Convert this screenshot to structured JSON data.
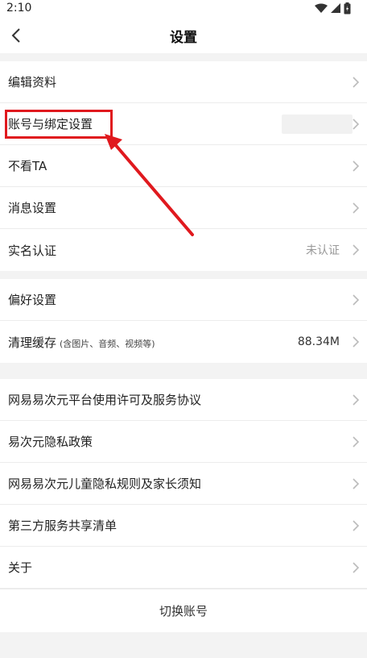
{
  "status": {
    "time": "2:10"
  },
  "header": {
    "title": "设置"
  },
  "groups": [
    {
      "items": [
        {
          "label": "编辑资料"
        },
        {
          "label": "账号与绑定设置"
        },
        {
          "label": "不看TA"
        },
        {
          "label": "消息设置"
        },
        {
          "label": "实名认证",
          "value": "未认证"
        }
      ]
    },
    {
      "items": [
        {
          "label": "偏好设置"
        },
        {
          "label": "清理缓存",
          "sub": "(含图片、音频、视频等)",
          "value": "88.34M"
        }
      ]
    },
    {
      "items": [
        {
          "label": "网易易次元平台使用许可及服务协议"
        },
        {
          "label": "易次元隐私政策"
        },
        {
          "label": "网易易次元儿童隐私规则及家长须知"
        },
        {
          "label": "第三方服务共享清单"
        },
        {
          "label": "关于"
        }
      ]
    }
  ],
  "footer": {
    "switch_account": "切换账号"
  },
  "colors": {
    "highlight": "#e0191e"
  }
}
